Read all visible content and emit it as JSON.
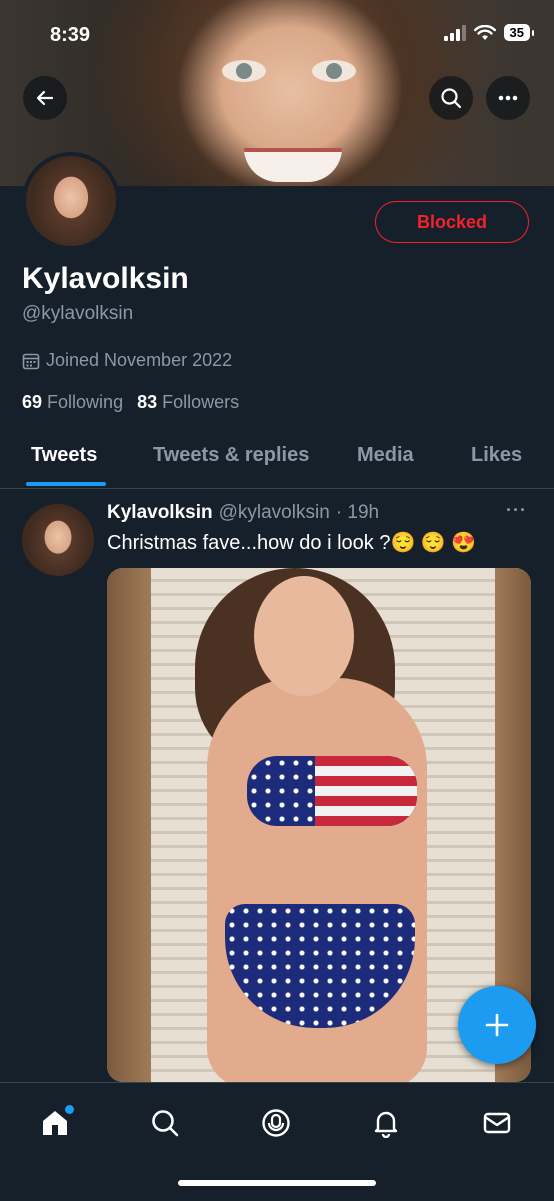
{
  "status_bar": {
    "time": "8:39",
    "battery": "35"
  },
  "profile": {
    "blocked_label": "Blocked",
    "display_name": "Kylavolksin",
    "handle": "@kylavolksin",
    "joined": "Joined November 2022",
    "following_count": "69",
    "following_label": "Following",
    "followers_count": "83",
    "followers_label": "Followers"
  },
  "tabs": [
    {
      "label": "Tweets",
      "active": true
    },
    {
      "label": "Tweets & replies",
      "active": false
    },
    {
      "label": "Media",
      "active": false
    },
    {
      "label": "Likes",
      "active": false
    }
  ],
  "tweet": {
    "name": "Kylavolksin",
    "handle": "@kylavolksin",
    "time": "· 19h",
    "text": "Christmas fave...how do i look ?😌 😌 😍",
    "more": "···"
  },
  "icons": {
    "back": "back-arrow-icon",
    "search": "search-icon",
    "more": "more-icon",
    "calendar": "calendar-icon",
    "compose": "plus-icon",
    "nav": [
      "home-icon",
      "search-icon",
      "spaces-icon",
      "notifications-icon",
      "messages-icon"
    ]
  },
  "colors": {
    "accent": "#1d9bf0",
    "blocked": "#f4212e",
    "background": "#15202b",
    "secondary_text": "#8b98a5"
  }
}
